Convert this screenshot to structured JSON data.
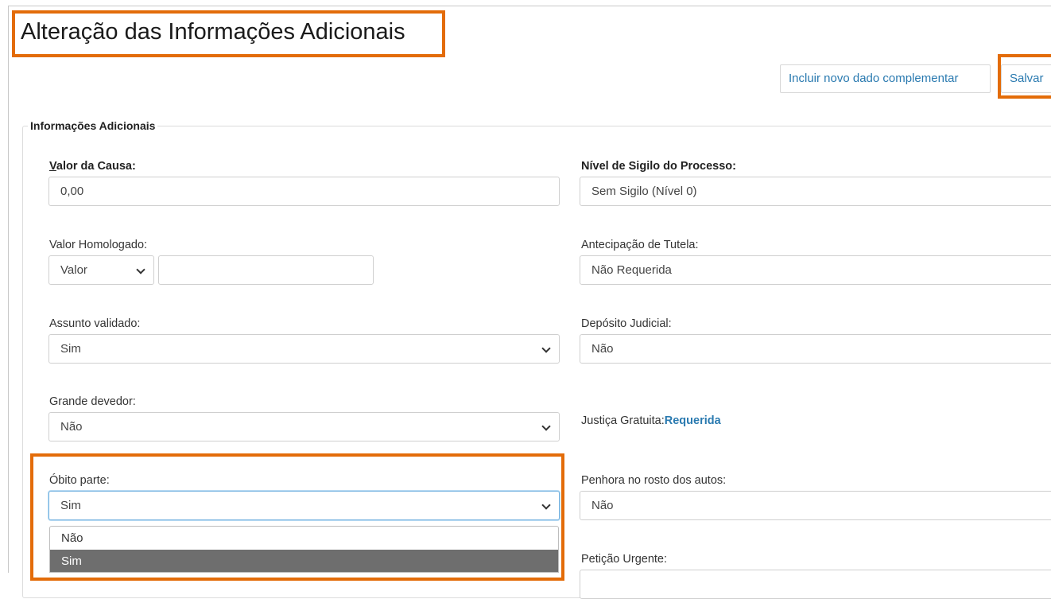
{
  "header": {
    "title": "Alteração das Informações Adicionais"
  },
  "toolbar": {
    "add_label": "Incluir novo dado complementar",
    "save_label": "Salvar"
  },
  "section": {
    "legend": "Informações Adicionais"
  },
  "fields": {
    "valor_causa": {
      "label_first": "V",
      "label_rest": "alor da Causa:",
      "value": "0,00"
    },
    "valor_homologado": {
      "label": "Valor Homologado:",
      "type_value": "Valor",
      "amount": ""
    },
    "assunto_validado": {
      "label": "Assunto validado:",
      "value": "Sim"
    },
    "grande_devedor": {
      "label": "Grande devedor:",
      "value": "Não"
    },
    "obito_parte": {
      "label": "Óbito parte:",
      "value": "Sim",
      "options": [
        "Não",
        "Sim"
      ]
    },
    "nivel_sigilo": {
      "label": "Nível de Sigilo do Processo:",
      "value": "Sem Sigilo (Nível 0)"
    },
    "antecipacao_tutela": {
      "label": "Antecipação de Tutela:",
      "value": "Não Requerida"
    },
    "deposito_judicial": {
      "label": "Depósito Judicial:",
      "value": "Não"
    },
    "justica_gratuita": {
      "label": "Justiça Gratuita:",
      "value": "Requerida"
    },
    "penhora": {
      "label": "Penhora no rosto dos autos:",
      "value": "Não"
    },
    "peticao_urgente": {
      "label": "Petição Urgente:"
    }
  },
  "colors": {
    "highlight": "#e36c09",
    "link": "#2a7ab0",
    "selected_option": "#6e6e6e"
  }
}
